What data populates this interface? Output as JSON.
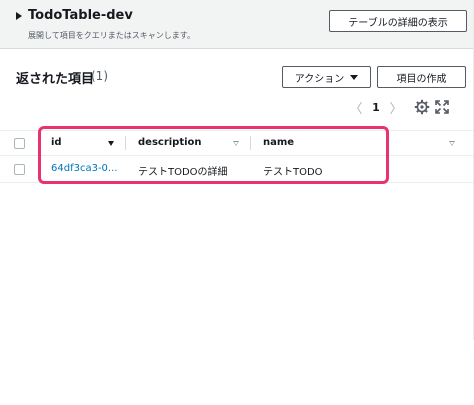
{
  "panel": {
    "title": "TodoTable-dev",
    "subtitle": "展開して項目をクエリまたはスキャンします。",
    "table_detail_button": "テーブルの詳細の表示"
  },
  "items": {
    "title": "返された項目",
    "count": "(1)",
    "action_button": "アクション",
    "create_button": "項目の作成"
  },
  "pagination": {
    "prev": "〈",
    "page": "1",
    "next": "〉"
  },
  "icons": {
    "settings": "gear-icon",
    "fullscreen": "expand-icon"
  },
  "table": {
    "columns": [
      {
        "label": "id"
      },
      {
        "label": "description"
      },
      {
        "label": "name"
      }
    ],
    "rows": [
      {
        "id": "64df3ca3-0...",
        "description": "テストTODOの詳細",
        "name": "テストTODO"
      }
    ]
  },
  "colors": {
    "highlight": "#e8336d",
    "link": "#0073bb"
  }
}
